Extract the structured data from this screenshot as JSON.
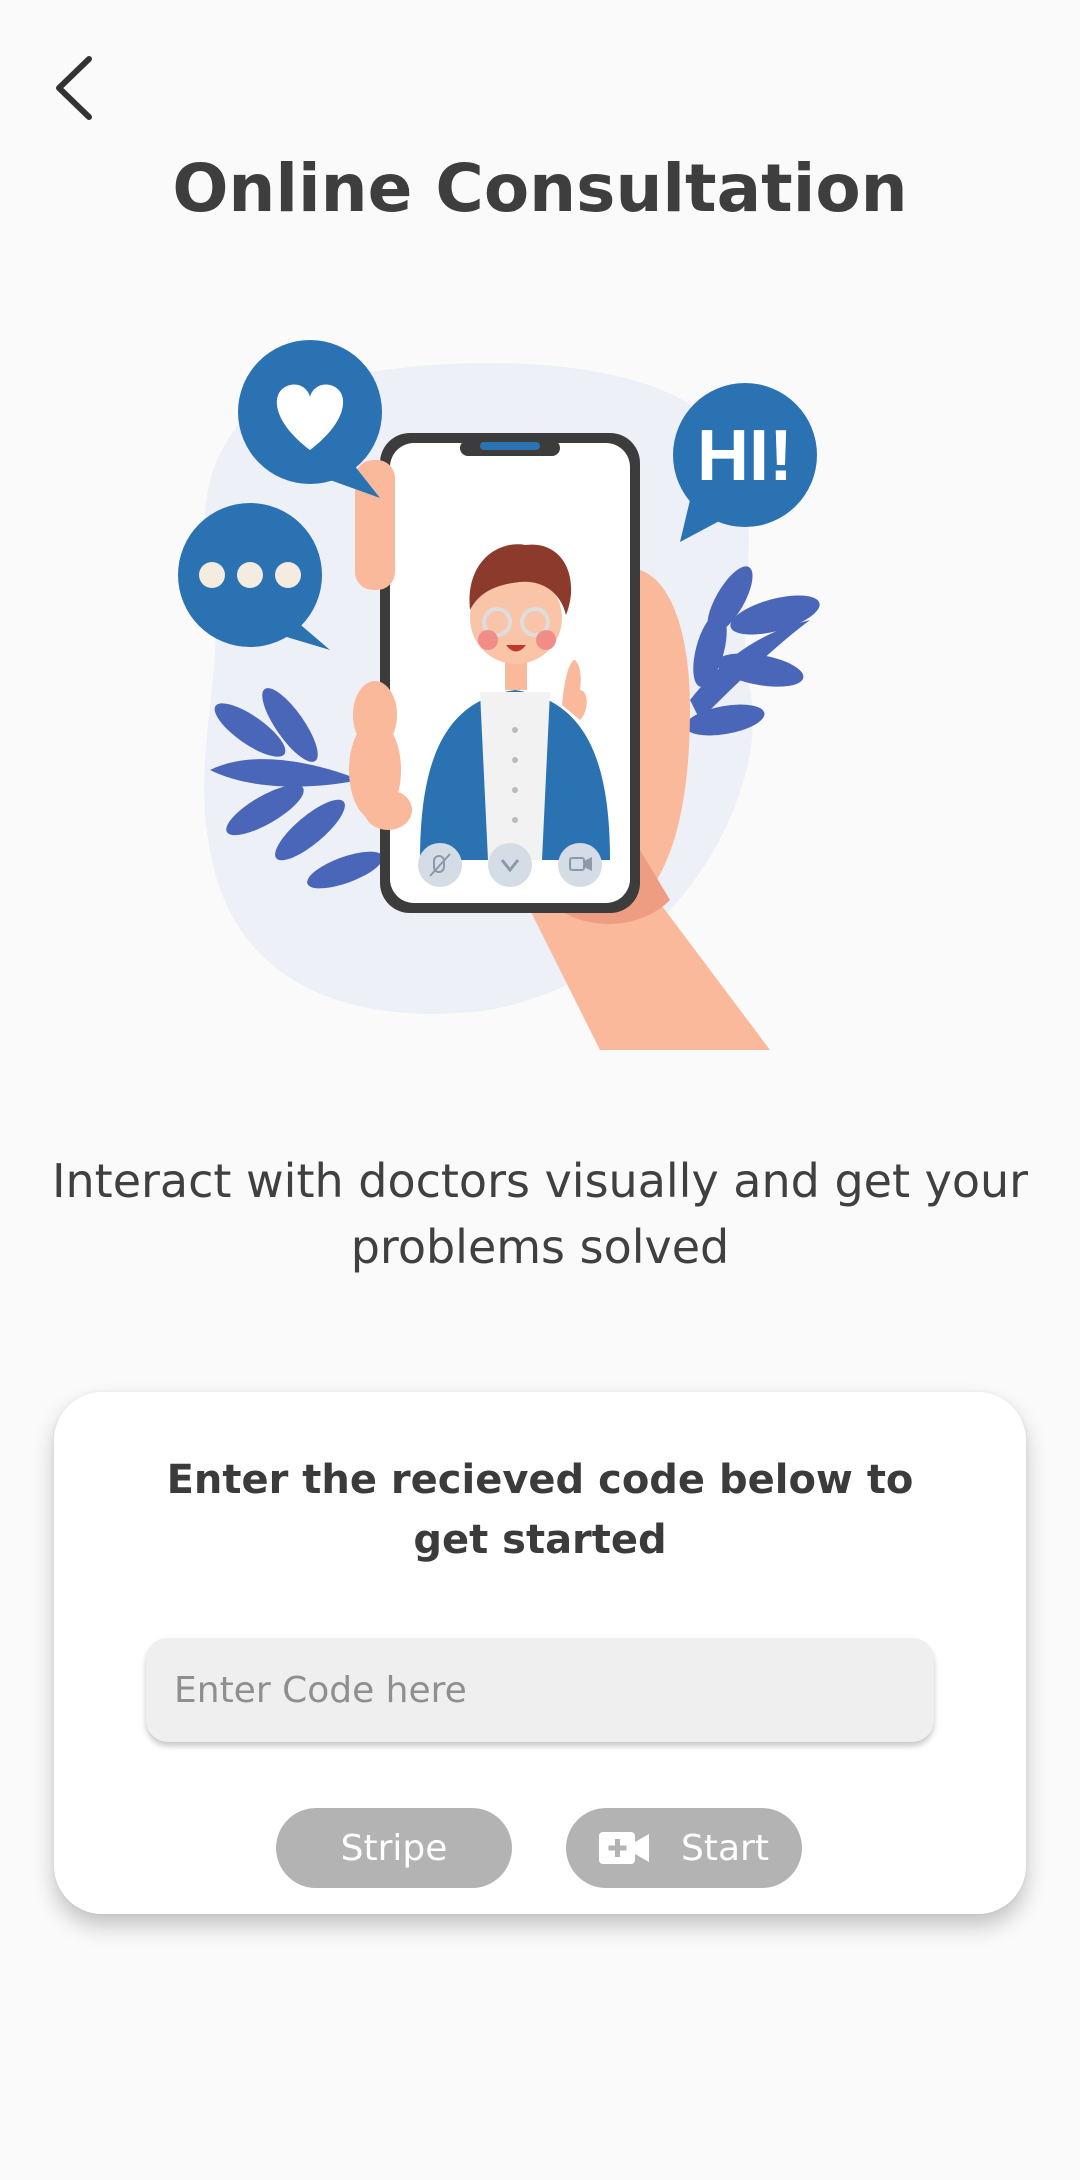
{
  "header": {
    "back_icon": "chevron-left-icon",
    "title": "Online Consultation"
  },
  "illustration": {
    "speech_bubble_text": "HI!",
    "icons": [
      "heart-icon",
      "ellipsis-icon",
      "mic-off-icon",
      "phone-icon",
      "video-icon"
    ],
    "colors": {
      "accent": "#2b72b3",
      "leaf": "#4a66b8",
      "skin": "#f9b99a"
    }
  },
  "main": {
    "subtitle": "Interact with doctors visually and get your problems solved"
  },
  "card": {
    "heading": "Enter the recieved code below to get started",
    "code_input": {
      "placeholder": "Enter Code here",
      "value": ""
    },
    "stripe_label": "Stripe",
    "start_label": "Start",
    "start_icon": "video-add-icon",
    "button_color": "#b3b3b3"
  }
}
